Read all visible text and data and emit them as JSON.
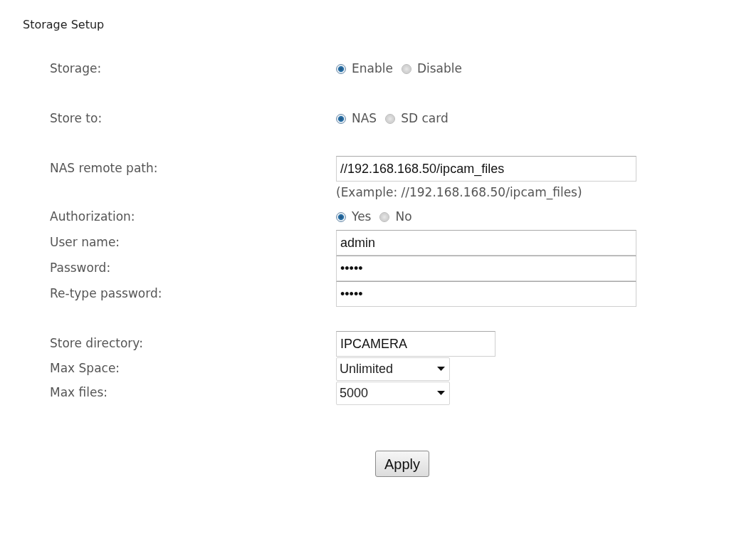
{
  "title": "Storage Setup",
  "sections": [
    {
      "rows": [
        {
          "kind": "radio",
          "label": "Storage:",
          "options": [
            {
              "label": "Enable",
              "selected": true
            },
            {
              "label": "Disable",
              "selected": false
            }
          ]
        }
      ]
    },
    {
      "rows": [
        {
          "kind": "radio",
          "label": "Store to:",
          "options": [
            {
              "label": "NAS",
              "selected": true
            },
            {
              "label": "SD card",
              "selected": false
            }
          ]
        }
      ]
    },
    {
      "rows": [
        {
          "kind": "text",
          "label": "NAS remote path:",
          "value": "//192.168.168.50/ipcam_files"
        },
        {
          "kind": "note",
          "text": "(Example: //192.168.168.50/ipcam_files)"
        },
        {
          "kind": "radio",
          "label": "Authorization:",
          "options": [
            {
              "label": "Yes",
              "selected": true
            },
            {
              "label": "No",
              "selected": false
            }
          ]
        },
        {
          "kind": "text",
          "label": "User name:",
          "value": "admin"
        },
        {
          "kind": "password",
          "label": "Password:",
          "value": "•••••"
        },
        {
          "kind": "password",
          "label": "Re-type password:",
          "value": "•••••"
        }
      ]
    },
    {
      "rows": [
        {
          "kind": "short",
          "label": "Store directory:",
          "value": "IPCAMERA"
        },
        {
          "kind": "select",
          "label": "Max Space:",
          "value": "Unlimited"
        },
        {
          "kind": "select",
          "label": "Max files:",
          "value": "5000"
        }
      ]
    }
  ],
  "apply_button": "Apply"
}
